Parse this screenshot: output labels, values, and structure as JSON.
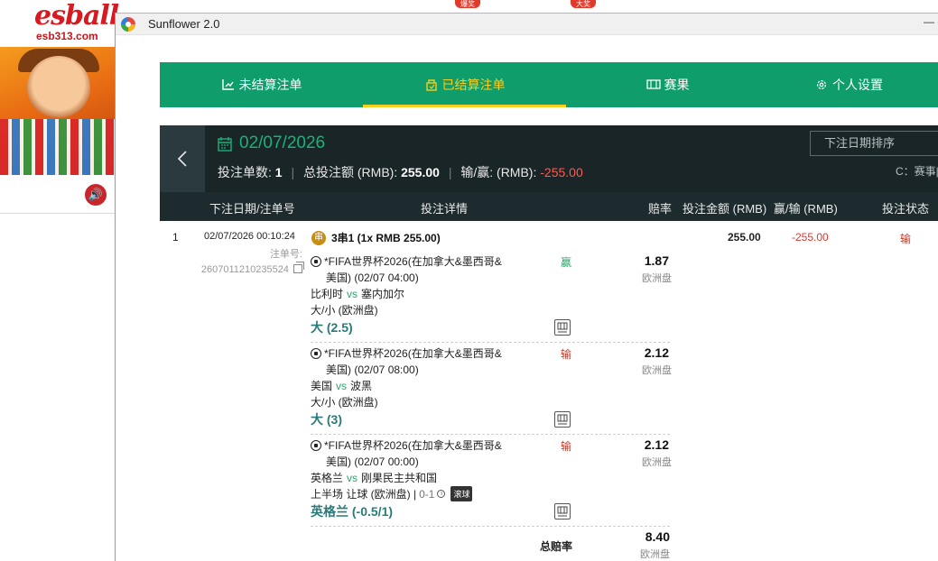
{
  "background_site": {
    "logo": "esball-",
    "url": "esb313.com",
    "tag_1": "爆奖",
    "tag_2": "大奖"
  },
  "window": {
    "title": "Sunflower 2.0",
    "icon": "sunflower-app-icon"
  },
  "nav": {
    "tabs": [
      {
        "label": "未结算注单",
        "icon": "unsettled-icon"
      },
      {
        "label": "已结算注单",
        "icon": "settled-icon",
        "active": true
      },
      {
        "label": "赛果",
        "icon": "results-icon"
      },
      {
        "label": "个人设置",
        "icon": "gear-icon"
      }
    ],
    "active_color": "#f5d020",
    "bg_color": "#0f9d6b"
  },
  "summary": {
    "date": "02/07/2026",
    "bet_count_label": "投注单数:",
    "bet_count": "1",
    "total_stake_label": "总投注额 (RMB):",
    "total_stake": "255.00",
    "winloss_label": "输/赢: (RMB):",
    "winloss": "-255.00",
    "sort_placeholder": "下注日期排序",
    "note": "C：赛事|"
  },
  "table": {
    "headers": {
      "date_id": "下注日期/注单号",
      "details": "投注详情",
      "odds": "赔率",
      "stake": "投注金额 (RMB)",
      "winloss": "赢/输 (RMB)",
      "status": "投注状态"
    }
  },
  "bet": {
    "index": "1",
    "datetime": "02/07/2026 00:10:24",
    "ticket_label": "注单号: ",
    "ticket_no": "2607011210235524",
    "combo_badge": "串",
    "combo": "3串1 (1x RMB 255.00)",
    "stake": "255.00",
    "winloss": "-255.00",
    "status": "输",
    "legs": [
      {
        "league": "*FIFA世界杯2026(在加拿大&墨西哥&",
        "league_cont": "美国) (02/07 04:00)",
        "home": "比利时",
        "vs": "vs",
        "away": "塞内加尔",
        "market": "大/小 (欧洲盘)",
        "pick": "大 (2.5)",
        "result": "赢",
        "result_type": "win",
        "odds": "1.87",
        "odds_type": "欧洲盘"
      },
      {
        "league": "*FIFA世界杯2026(在加拿大&墨西哥&",
        "league_cont": "美国) (02/07 08:00)",
        "home": "美国",
        "vs": "vs",
        "away": "波黑",
        "market": "大/小 (欧洲盘)",
        "pick": "大 (3)",
        "result": "输",
        "result_type": "loss",
        "odds": "2.12",
        "odds_type": "欧洲盘"
      },
      {
        "league": "*FIFA世界杯2026(在加拿大&墨西哥&",
        "league_cont": "美国) (02/07 00:00)",
        "home": "英格兰",
        "vs": "vs",
        "away": "刚果民主共和国",
        "market": "上半场 让球 (欧洲盘) |",
        "score": "0-1",
        "live_tag": "滚球",
        "pick": "英格兰 (-0.5/1)",
        "result": "输",
        "result_type": "loss",
        "odds": "2.12",
        "odds_type": "欧洲盘"
      }
    ],
    "total_odds_label": "总赔率",
    "total_odds": "8.40",
    "total_odds_type": "欧洲盘"
  }
}
